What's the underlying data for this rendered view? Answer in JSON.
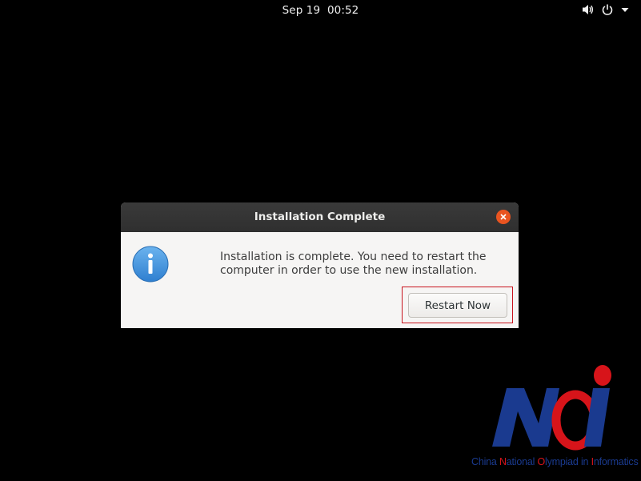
{
  "topbar": {
    "date": "Sep 19",
    "time": "00:52",
    "icons": [
      "volume-icon",
      "power-icon",
      "chevron-down-icon"
    ]
  },
  "dialog": {
    "title": "Installation Complete",
    "message": "Installation is complete. You need to restart the computer in order to use the new installation.",
    "icon": "info-icon",
    "restart_label": "Restart Now",
    "close_icon": "close-icon"
  },
  "logo": {
    "text": "NOI",
    "caption_parts": [
      "China ",
      "N",
      "ational ",
      "O",
      "lympiad in ",
      "I",
      "nformatics"
    ],
    "colors": {
      "blue": "#1a3a8f",
      "red": "#d7141a"
    }
  },
  "colors": {
    "background": "#000000",
    "accent": "#e95420",
    "highlight_border": "#c8141e"
  }
}
